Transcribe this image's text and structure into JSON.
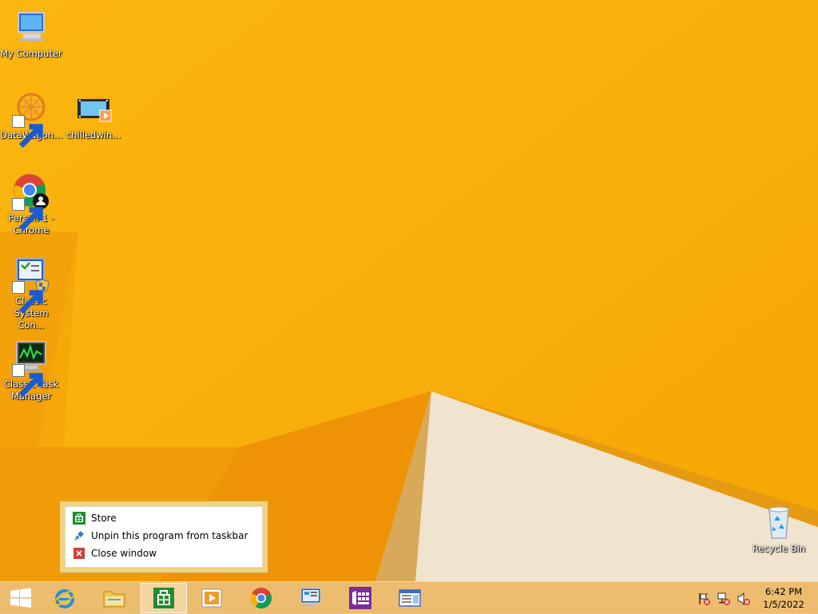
{
  "desktop": {
    "icons": [
      {
        "label": "My Computer"
      },
      {
        "label": "DataWagon..."
      },
      {
        "label": "chilledwin..."
      },
      {
        "label": "Person 1 - Chrome"
      },
      {
        "label": "Classic System Con..."
      },
      {
        "label": "Classic Task Manager"
      },
      {
        "label": "Recycle Bin"
      }
    ]
  },
  "jumplist": {
    "items": [
      {
        "label": "Store",
        "icon": "store-icon"
      },
      {
        "label": "Unpin this program from taskbar",
        "icon": "unpin-icon"
      },
      {
        "label": "Close window",
        "icon": "close-icon"
      }
    ]
  },
  "taskbar": {
    "buttons": [
      {
        "name": "start",
        "icon": "windows-logo-icon"
      },
      {
        "name": "internet-explorer",
        "icon": "ie-icon"
      },
      {
        "name": "file-explorer",
        "icon": "folder-icon"
      },
      {
        "name": "store",
        "icon": "store-icon",
        "active": true
      },
      {
        "name": "media-player",
        "icon": "media-player-icon"
      },
      {
        "name": "chrome",
        "icon": "chrome-icon"
      },
      {
        "name": "control-panel",
        "icon": "control-panel-icon"
      },
      {
        "name": "onenote",
        "icon": "app-tiles-icon"
      },
      {
        "name": "window-app",
        "icon": "window-icon"
      }
    ]
  },
  "tray": {
    "time": "6:42 PM",
    "date": "1/5/2022"
  },
  "colors": {
    "wallpaper": "#f9b20e",
    "taskbar": "#ecbe78",
    "accent_store": "#1f8c2e"
  }
}
